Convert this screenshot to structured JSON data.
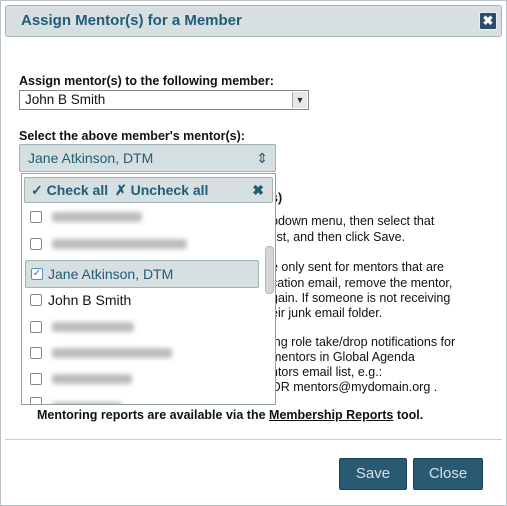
{
  "dialog": {
    "title": "Assign Mentor(s) for a Member",
    "close_glyph": "✖"
  },
  "member": {
    "label": "Assign mentor(s) to the following member:",
    "value": "John B Smith"
  },
  "mentors": {
    "label": "Select the above member's mentor(s):",
    "selected": "Jane Atkinson, DTM"
  },
  "dropdown": {
    "check_all": "✓ Check all",
    "uncheck_all": "✗ Uncheck all",
    "close_glyph": "✖",
    "items": [
      {
        "label": "",
        "checked": false
      },
      {
        "label": "",
        "checked": false
      },
      {
        "label": "Jane Atkinson, DTM",
        "checked": true
      },
      {
        "label": "John B Smith",
        "checked": false
      },
      {
        "label": "",
        "checked": false
      },
      {
        "label": "",
        "checked": false
      },
      {
        "label": "",
        "checked": false
      },
      {
        "label": "",
        "checked": false
      }
    ]
  },
  "background_text": {
    "heading_fragment": "s)",
    "lines": [
      "pdown menu, then select that",
      "list, and then click Save.",
      "e only sent for mentors that are",
      "cation email, remove the mentor,",
      "gain. If someone is not receiving",
      "eir junk email folder.",
      "ing role take/drop notifications for",
      "mentors in Global Agenda",
      "ntors email list, e.g.:",
      "OR mentors@mydomain.org ."
    ]
  },
  "footer": {
    "prefix": "Mentoring reports are available via the ",
    "link": "Membership Reports",
    "suffix": " tool."
  },
  "buttons": {
    "save": "Save",
    "close": "Close"
  }
}
